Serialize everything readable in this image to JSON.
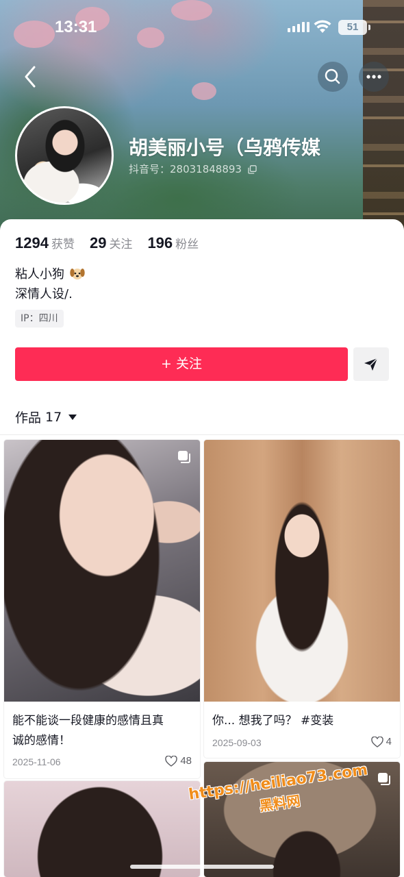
{
  "status_bar": {
    "time": "13:31",
    "battery": "51"
  },
  "profile": {
    "name": "胡美丽小号（乌鸦传媒",
    "douyin_id": "抖音号：28031848893",
    "stats": [
      {
        "value": "1294",
        "label": "获赞"
      },
      {
        "value": "29",
        "label": "关注"
      },
      {
        "value": "196",
        "label": "粉丝"
      }
    ],
    "bio_line1": "粘人小狗",
    "bio_line2": "深情人设/.",
    "ip": "IP：四川"
  },
  "actions": {
    "follow_label": "+ 关注"
  },
  "works_tab": {
    "label": "作品",
    "count": "17"
  },
  "posts": [
    {
      "title_line1": "能不能谈一段健康的感情且真",
      "title_line2": "诚的感情！",
      "date": "2025-11-06",
      "likes": "48"
    },
    {
      "title_line1": "你... 想我了吗？ #变装",
      "title_line2": "",
      "date": "2025-09-03",
      "likes": "4"
    }
  ],
  "watermark": {
    "url": "https://heiliao73.com",
    "text": "黑料网"
  },
  "colors": {
    "accent": "#fe2c55",
    "watermark": "#f08d1b"
  }
}
